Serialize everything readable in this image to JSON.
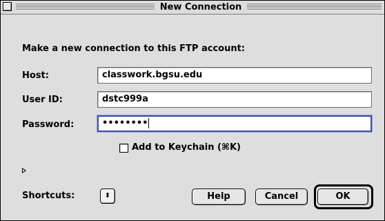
{
  "window": {
    "title": "New Connection"
  },
  "prompt": "Make a new connection to this FTP account:",
  "fields": {
    "host": {
      "label": "Host:",
      "value": "classwork.bgsu.edu"
    },
    "user": {
      "label": "User ID:",
      "value": "dstc999a"
    },
    "password": {
      "label": "Password:",
      "value": "••••••••"
    }
  },
  "keychain": {
    "label": "Add to Keychain (⌘K)",
    "checked": false
  },
  "shortcuts": {
    "label": "Shortcuts:",
    "icon": "up-down-arrows-icon"
  },
  "buttons": {
    "help": "Help",
    "cancel": "Cancel",
    "ok": "OK"
  }
}
